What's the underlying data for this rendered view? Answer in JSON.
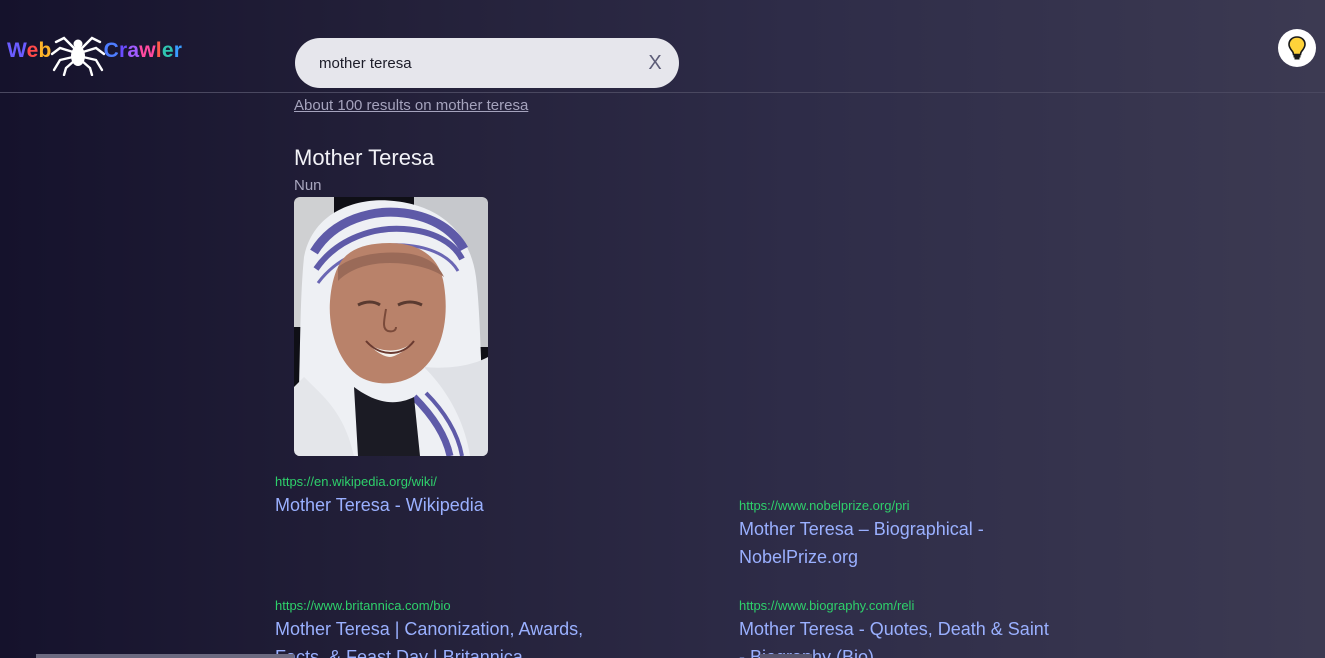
{
  "logo": {
    "part1": "Web",
    "part2": "Crawler",
    "icon": "spider-icon"
  },
  "search": {
    "query": "mother teresa",
    "clear_label": "X"
  },
  "theme_toggle": {
    "icon": "lightbulb-icon"
  },
  "results_count": "About 100 results on mother teresa",
  "knowledge_panel": {
    "title": "Mother Teresa",
    "subtitle": "Nun",
    "image": "portrait-photo"
  },
  "results": [
    {
      "url": "https://en.wikipedia.org/wiki/",
      "title": "Mother Teresa - Wikipedia"
    },
    {
      "url": "https://www.nobelprize.org/pri",
      "title": "Mother Teresa – Biographical - NobelPrize.org"
    },
    {
      "url": "https://www.britannica.com/bio",
      "title": "Mother Teresa | Canonization, Awards, Facts, & Feast Day | Britannica"
    },
    {
      "url": "https://www.biography.com/reli",
      "title": "Mother Teresa - Quotes, Death & Saint - Biography (Bio)"
    }
  ],
  "colors": {
    "url_green": "#2ed06b",
    "link_blue": "#9ab0ff",
    "bg_dark": "#15122c",
    "bg_light": "#3c3a52"
  }
}
